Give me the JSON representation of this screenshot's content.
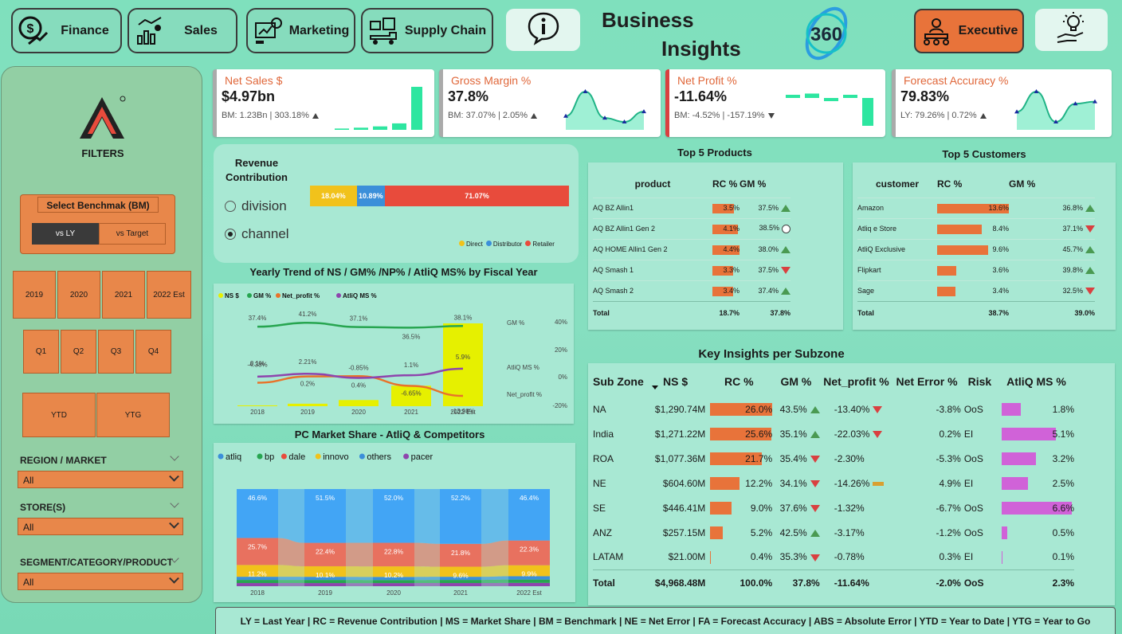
{
  "nav": {
    "finance": "Finance",
    "sales": "Sales",
    "marketing": "Marketing",
    "supply_chain": "Supply Chain",
    "title_line1": "Business",
    "title_line2": "Insights",
    "logo_text": "360",
    "executive": "Executive"
  },
  "filters": {
    "title": "FILTERS",
    "benchmark_title": "Select Benchmak (BM)",
    "bm_options": [
      "vs LY",
      "vs Target"
    ],
    "bm_selected": "vs LY",
    "years": [
      "2019",
      "2020",
      "2021",
      "2022 Est"
    ],
    "quarters": [
      "Q1",
      "Q2",
      "Q3",
      "Q4"
    ],
    "periods": [
      "YTD",
      "YTG"
    ],
    "region_label": "REGION / MARKET",
    "region_value": "All",
    "store_label": "STORE(S)",
    "store_value": "All",
    "segment_label": "SEGMENT/CATEGORY/PRODUCT",
    "segment_value": "All"
  },
  "kpis": [
    {
      "title": "Net Sales $",
      "value": "$4.97bn",
      "sub": "BM: 1.23Bn | 303.18%",
      "trend": "up",
      "border": "#aaaaaa",
      "spark": [
        3,
        5,
        8,
        15,
        100
      ],
      "spark_type": "bar"
    },
    {
      "title": "Gross Margin %",
      "value": "37.8%",
      "sub": "BM: 37.07% | 2.05%",
      "trend": "up",
      "border": "#aaaaaa",
      "spark": [
        37.4,
        41.2,
        37.1,
        36.5,
        38.1
      ],
      "spark_type": "area"
    },
    {
      "title": "Net Profit %",
      "value": "-11.64%",
      "sub": "BM: -4.52% | -157.19%",
      "trend": "down",
      "border": "#d94040",
      "spark": [
        0.1,
        2.21,
        -0.85,
        1.1,
        -13.98
      ],
      "spark_type": "waterfall"
    },
    {
      "title": "Forecast Accuracy %",
      "value": "79.83%",
      "sub": "LY: 79.26% | 0.72%",
      "trend": "up",
      "border": "#aaaaaa",
      "spark": [
        80,
        90,
        75,
        84,
        85
      ],
      "spark_type": "area"
    }
  ],
  "revenue_contribution": {
    "title": "Revenue Contribution",
    "options": [
      "division",
      "channel"
    ],
    "selected": "channel",
    "segments": [
      {
        "label": "18.04%",
        "value": 18.04,
        "color": "#f1c21b"
      },
      {
        "label": "10.89%",
        "value": 10.89,
        "color": "#3b8fd9"
      },
      {
        "label": "71.07%",
        "value": 71.07,
        "color": "#e84b3c"
      }
    ],
    "legend": [
      {
        "name": "Direct",
        "color": "#f1c21b"
      },
      {
        "name": "Distributor",
        "color": "#3b8fd9"
      },
      {
        "name": "Retailer",
        "color": "#e84b3c"
      }
    ]
  },
  "top_products": {
    "title": "Top 5 Products",
    "headers": [
      "product",
      "RC %",
      "GM %"
    ],
    "rows": [
      {
        "name": "AQ BZ Allin1",
        "rc": "3.5%",
        "rc_val": 3.5,
        "gm": "37.5%",
        "ind": "up"
      },
      {
        "name": "AQ BZ Allin1 Gen 2",
        "rc": "4.1%",
        "rc_val": 4.1,
        "gm": "38.5%",
        "ind": "circle"
      },
      {
        "name": "AQ HOME Allin1 Gen 2",
        "rc": "4.4%",
        "rc_val": 4.4,
        "gm": "38.0%",
        "ind": "up"
      },
      {
        "name": "AQ Smash 1",
        "rc": "3.3%",
        "rc_val": 3.3,
        "gm": "37.5%",
        "ind": "down"
      },
      {
        "name": "AQ Smash 2",
        "rc": "3.4%",
        "rc_val": 3.4,
        "gm": "37.4%",
        "ind": "up"
      }
    ],
    "total": {
      "label": "Total",
      "rc": "18.7%",
      "gm": "37.8%"
    }
  },
  "top_customers": {
    "title": "Top 5 Customers",
    "headers": [
      "customer",
      "RC %",
      "GM %"
    ],
    "rows": [
      {
        "name": "Amazon",
        "rc": "13.6%",
        "rc_val": 13.6,
        "gm": "36.8%",
        "ind": "up"
      },
      {
        "name": "Atliq e Store",
        "rc": "8.4%",
        "rc_val": 8.4,
        "gm": "37.1%",
        "ind": "down"
      },
      {
        "name": "AtliQ Exclusive",
        "rc": "9.6%",
        "rc_val": 9.6,
        "gm": "45.7%",
        "ind": "up"
      },
      {
        "name": "Flipkart",
        "rc": "3.6%",
        "rc_val": 3.6,
        "gm": "39.8%",
        "ind": "up"
      },
      {
        "name": "Sage",
        "rc": "3.4%",
        "rc_val": 3.4,
        "gm": "32.5%",
        "ind": "down"
      }
    ],
    "total": {
      "label": "Total",
      "rc": "38.7%",
      "gm": "39.0%"
    }
  },
  "yearly_trend": {
    "title": "Yearly Trend of NS / GM% /NP% / AtliQ MS% by Fiscal Year",
    "legend": [
      {
        "name": "NS $",
        "color": "#e6f000"
      },
      {
        "name": "GM %",
        "color": "#27a550"
      },
      {
        "name": "Net_profit %",
        "color": "#e8732a"
      },
      {
        "name": "AtliQ MS %",
        "color": "#8e44ad"
      }
    ],
    "right_labels": [
      "GM %",
      "AtliQ MS %",
      "Net_profit %"
    ],
    "right_ticks": [
      "40%",
      "20%",
      "0%",
      "-20%"
    ]
  },
  "market_share": {
    "title": "PC Market Share - AtliQ & Competitors",
    "legend": [
      {
        "name": "atliq",
        "color": "#3b8fd9"
      },
      {
        "name": "bp",
        "color": "#27a550"
      },
      {
        "name": "dale",
        "color": "#e84b3c"
      },
      {
        "name": "innovo",
        "color": "#f1c21b"
      },
      {
        "name": "others",
        "color": "#3b8fd9"
      },
      {
        "name": "pacer",
        "color": "#8e44ad"
      }
    ]
  },
  "chart_data": [
    {
      "type": "bar",
      "title": "Yearly Trend of NS / GM% /NP% / AtliQ MS% by Fiscal Year",
      "categories": [
        "2018",
        "2019",
        "2020",
        "2021",
        "2022 Est"
      ],
      "series": [
        {
          "name": "NS $",
          "kind": "bar",
          "values": [
            0.05,
            0.15,
            0.37,
            1.23,
            4.97
          ]
        },
        {
          "name": "GM %",
          "kind": "line",
          "values": [
            37.4,
            41.2,
            37.1,
            36.5,
            38.1
          ],
          "labels": [
            "37.4%",
            "41.2%",
            "37.1%",
            "36.5%",
            "38.1%"
          ]
        },
        {
          "name": "Net_profit %",
          "kind": "line",
          "values": [
            -4.38,
            0.2,
            0.4,
            -6.65,
            -13.98
          ],
          "labels": [
            "-4.38%",
            "0.2%",
            "0.4%",
            "-6.65%",
            "-13.98%"
          ]
        },
        {
          "name": "AtliQ MS %",
          "kind": "line",
          "values": [
            0.1,
            2.21,
            -0.85,
            1.1,
            5.9
          ],
          "labels": [
            "0.1%",
            "2.21%",
            "-0.85%",
            "1.1%",
            "5.9%"
          ]
        }
      ],
      "ylim": [
        -20,
        40
      ]
    },
    {
      "type": "bar",
      "title": "PC Market Share - AtliQ & Competitors",
      "categories": [
        "2018",
        "2019",
        "2020",
        "2021",
        "2022 Est"
      ],
      "series": [
        {
          "name": "pacer",
          "values": [
            3.0,
            3.0,
            3.0,
            3.0,
            3.0
          ],
          "color": "#8e44ad",
          "labels": [
            "",
            "",
            "",
            "",
            ""
          ]
        },
        {
          "name": "bp",
          "values": [
            3.0,
            3.0,
            3.0,
            3.0,
            3.0
          ],
          "color": "#27a550",
          "labels": [
            "",
            "",
            "",
            "",
            ""
          ]
        },
        {
          "name": "atliq",
          "values": [
            3.0,
            3.0,
            3.0,
            3.0,
            3.0
          ],
          "color": "#3b8fd9",
          "labels": [
            "",
            "",
            "",
            "",
            ""
          ]
        },
        {
          "name": "innovo",
          "values": [
            11.2,
            10.1,
            10.2,
            9.6,
            9.9
          ],
          "color": "#f1c21b",
          "labels": [
            "11.2%",
            "10.1%",
            "10.2%",
            "9.6%",
            "9.9%"
          ]
        },
        {
          "name": "dale",
          "values": [
            25.7,
            22.4,
            22.8,
            21.8,
            22.3
          ],
          "color": "#e8715f",
          "labels": [
            "25.7%",
            "22.4%",
            "22.8%",
            "21.8%",
            "22.3%"
          ]
        },
        {
          "name": "others",
          "values": [
            46.6,
            51.5,
            52.0,
            52.2,
            46.4
          ],
          "color": "#42a5f5",
          "labels": [
            "46.6%",
            "51.5%",
            "52.0%",
            "52.2%",
            "46.4%"
          ]
        }
      ]
    }
  ],
  "subzone": {
    "title": "Key Insights per Subzone",
    "headers": [
      "Sub Zone",
      "NS $",
      "RC %",
      "GM %",
      "Net_profit %",
      "Net Error %",
      "Risk",
      "AtliQ MS %"
    ],
    "rows": [
      {
        "zone": "NA",
        "ns": "$1,290.74M",
        "rc": "26.0%",
        "rc_val": 26.0,
        "gm": "43.5%",
        "gm_ind": "up",
        "np": "-13.40%",
        "np_ind": "down",
        "ne": "-3.8%",
        "risk": "OoS",
        "ms": "1.8%",
        "ms_val": 1.8
      },
      {
        "zone": "India",
        "ns": "$1,271.22M",
        "rc": "25.6%",
        "rc_val": 25.6,
        "gm": "35.1%",
        "gm_ind": "up",
        "np": "-22.03%",
        "np_ind": "down",
        "ne": "0.2%",
        "risk": "EI",
        "ms": "5.1%",
        "ms_val": 5.1
      },
      {
        "zone": "ROA",
        "ns": "$1,077.36M",
        "rc": "21.7%",
        "rc_val": 21.7,
        "gm": "35.4%",
        "gm_ind": "down",
        "np": "-2.30%",
        "np_ind": "",
        "ne": "-5.3%",
        "risk": "OoS",
        "ms": "3.2%",
        "ms_val": 3.2
      },
      {
        "zone": "NE",
        "ns": "$604.60M",
        "rc": "12.2%",
        "rc_val": 12.2,
        "gm": "34.1%",
        "gm_ind": "down",
        "np": "-14.26%",
        "np_ind": "eq",
        "ne": "4.9%",
        "risk": "EI",
        "ms": "2.5%",
        "ms_val": 2.5
      },
      {
        "zone": "SE",
        "ns": "$446.41M",
        "rc": "9.0%",
        "rc_val": 9.0,
        "gm": "37.6%",
        "gm_ind": "down",
        "np": "-1.32%",
        "np_ind": "",
        "ne": "-6.7%",
        "risk": "OoS",
        "ms": "6.6%",
        "ms_val": 6.6
      },
      {
        "zone": "ANZ",
        "ns": "$257.15M",
        "rc": "5.2%",
        "rc_val": 5.2,
        "gm": "42.5%",
        "gm_ind": "up",
        "np": "-3.17%",
        "np_ind": "",
        "ne": "-1.2%",
        "risk": "OoS",
        "ms": "0.5%",
        "ms_val": 0.5
      },
      {
        "zone": "LATAM",
        "ns": "$21.00M",
        "rc": "0.4%",
        "rc_val": 0.4,
        "gm": "35.3%",
        "gm_ind": "down",
        "np": "-0.78%",
        "np_ind": "",
        "ne": "0.3%",
        "risk": "EI",
        "ms": "0.1%",
        "ms_val": 0.1
      }
    ],
    "total": {
      "zone": "Total",
      "ns": "$4,968.48M",
      "rc": "100.0%",
      "gm": "37.8%",
      "np": "-11.64%",
      "ne": "-2.0%",
      "risk": "OoS",
      "ms": "2.3%"
    }
  },
  "footer": "LY = Last Year | RC = Revenue Contribution | MS = Market Share | BM = Benchmark | NE = Net Error | FA = Forecast Accuracy | ABS = Absolute Error | YTD = Year to Date | YTG = Year to Go",
  "colors": {
    "accent": "#e8874a",
    "bar_orange": "#e8733a",
    "ms_purple": "#d062d8",
    "title_orange": "#e0673a"
  },
  "icons": [
    "finance-icon",
    "sales-icon",
    "marketing-icon",
    "supply-chain-icon",
    "info-icon",
    "executive-icon",
    "idea-icon"
  ]
}
